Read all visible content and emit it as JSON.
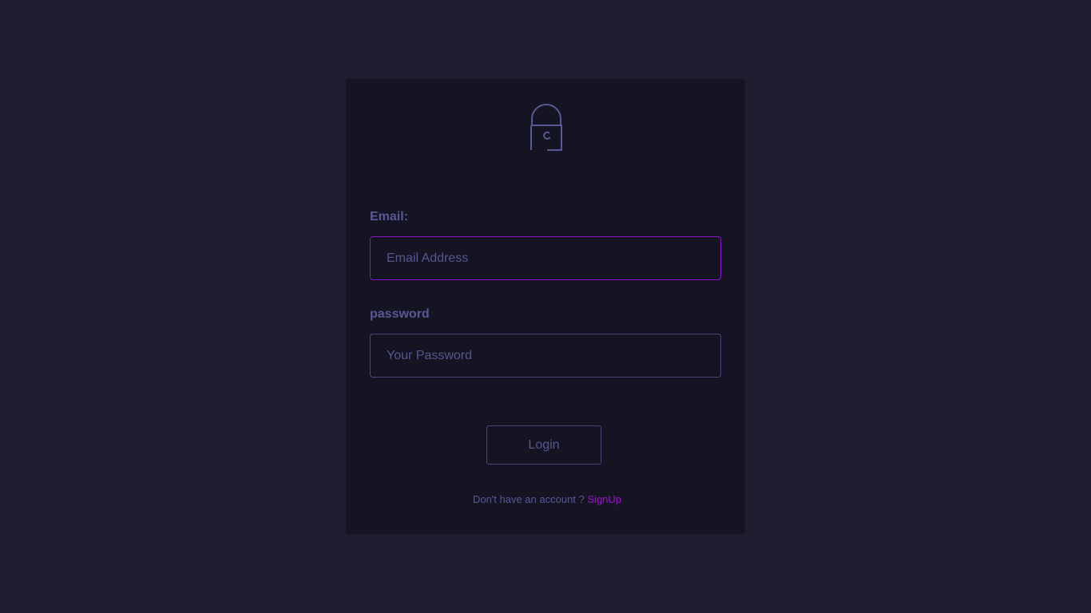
{
  "login_form": {
    "lock_icon": "padlock-icon",
    "email": {
      "label": "Email:",
      "placeholder": "Email Address",
      "value": ""
    },
    "password": {
      "label": "password",
      "placeholder": "Your Password",
      "value": ""
    },
    "login_button_label": "Login",
    "signup_prompt": "Don't have an account ?",
    "signup_link_label": "SignUp"
  },
  "colors": {
    "page_background": "#1e1e30",
    "card_background": "#141423",
    "label_text": "#5c5796",
    "focused_border_accent": "#8b12c9",
    "link_accent": "#a20fd6",
    "default_border": "#4a467a"
  }
}
